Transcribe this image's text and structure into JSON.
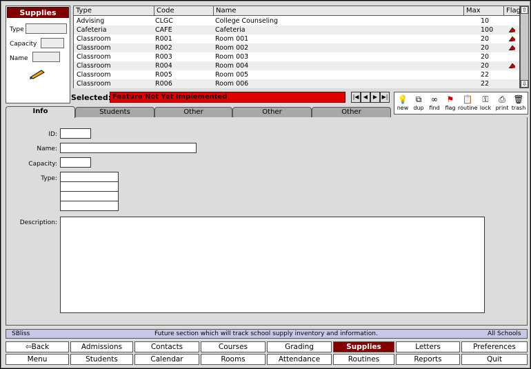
{
  "filter": {
    "title": "Supplies",
    "type_label": "Type",
    "capacity_label": "Capacity",
    "name_label": "Name"
  },
  "table": {
    "columns": [
      "Type",
      "Code",
      "Name",
      "Max",
      "Flag"
    ],
    "rows": [
      {
        "type": "Advising",
        "code": "CLGC",
        "name": "College Counseling",
        "max": "10",
        "flag": false
      },
      {
        "type": "Cafeteria",
        "code": "CAFE",
        "name": "Cafeteria",
        "max": "100",
        "flag": true
      },
      {
        "type": "Classroom",
        "code": "R001",
        "name": "Room 001",
        "max": "20",
        "flag": true
      },
      {
        "type": "Classroom",
        "code": "R002",
        "name": "Room 002",
        "max": "20",
        "flag": true
      },
      {
        "type": "Classroom",
        "code": "R003",
        "name": "Room 003",
        "max": "20",
        "flag": false
      },
      {
        "type": "Classroom",
        "code": "R004",
        "name": "Room 004",
        "max": "20",
        "flag": true
      },
      {
        "type": "Classroom",
        "code": "R005",
        "name": "Room 005",
        "max": "22",
        "flag": false
      },
      {
        "type": "Classroom",
        "code": "R006",
        "name": "Room 006",
        "max": "22",
        "flag": false
      }
    ]
  },
  "selected": {
    "label": "Selected:",
    "value": "Feature Not Yet Implemented"
  },
  "toolbar": {
    "new": "new",
    "dup": "dup",
    "find": "find",
    "flag": "flag",
    "routine": "routine",
    "lock": "lock",
    "print": "print",
    "trash": "trash"
  },
  "tabs": [
    "Info",
    "Students",
    "Other",
    "Other",
    "Other"
  ],
  "form": {
    "id_label": "ID:",
    "name_label": "Name:",
    "capacity_label": "Capacity:",
    "type_label": "Type:",
    "description_label": "Description:"
  },
  "status": {
    "left": "SBliss",
    "center": "Future section which will track school supply inventory and information.",
    "right": "All Schools"
  },
  "nav": {
    "row1": [
      "Back",
      "Admissions",
      "Contacts",
      "Courses",
      "Grading",
      "Supplies",
      "Letters",
      "Preferences"
    ],
    "row2": [
      "Menu",
      "Students",
      "Calendar",
      "Rooms",
      "Attendance",
      "Routines",
      "Reports",
      "Quit"
    ]
  },
  "colors": {
    "accent": "#800000",
    "selected_bar": "#e00000",
    "status_bg": "#c8c8e6"
  }
}
